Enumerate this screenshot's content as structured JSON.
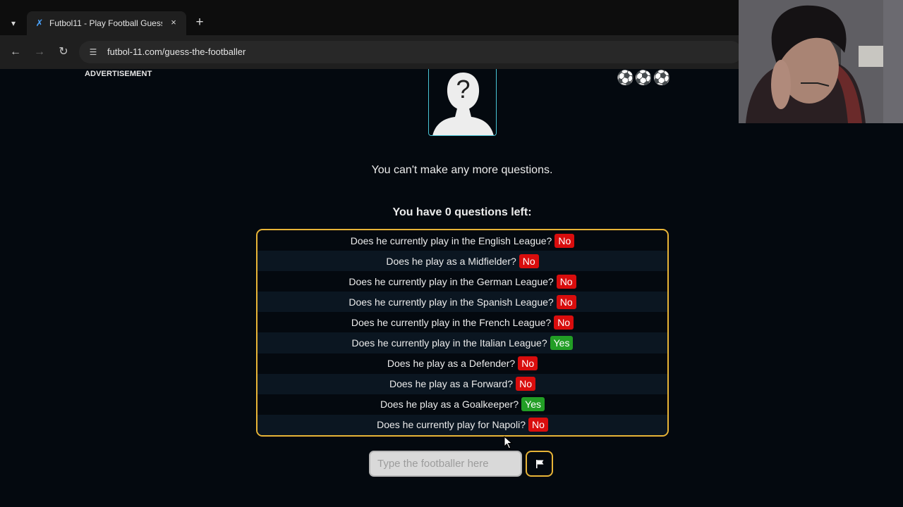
{
  "browser": {
    "tab_title": "Futbol11 - Play Football Guess",
    "url": "futbol-11.com/guess-the-footballer",
    "tab_list_icon": "chevron-down-icon",
    "new_tab_label": "+",
    "close_tab_label": "×"
  },
  "page": {
    "advertisement_label": "ADVERTISEMENT",
    "balls": "⚽⚽⚽",
    "status_message": "You can't make any more questions.",
    "questions_left_message": "You have 0 questions left:",
    "questions": [
      {
        "text": "Does he currently play in the English League?",
        "answer": "No"
      },
      {
        "text": "Does he play as a Midfielder?",
        "answer": "No"
      },
      {
        "text": "Does he currently play in the German League?",
        "answer": "No"
      },
      {
        "text": "Does he currently play in the Spanish League?",
        "answer": "No"
      },
      {
        "text": "Does he currently play in the French League?",
        "answer": "No"
      },
      {
        "text": "Does he currently play in the Italian League?",
        "answer": "Yes"
      },
      {
        "text": "Does he play as a Defender?",
        "answer": "No"
      },
      {
        "text": "Does he play as a Forward?",
        "answer": "No"
      },
      {
        "text": "Does he play as a Goalkeeper?",
        "answer": "Yes"
      },
      {
        "text": "Does he currently play for Napoli?",
        "answer": "No"
      }
    ],
    "input_placeholder": "Type the footballer here",
    "input_value": "",
    "flag_button_icon": "flag-icon"
  },
  "colors": {
    "page_background": "#04090f",
    "answer_no": "#d90d0d",
    "answer_yes": "#229e25",
    "panel_border": "#e8b437",
    "avatar_border": "#49c5d6"
  }
}
